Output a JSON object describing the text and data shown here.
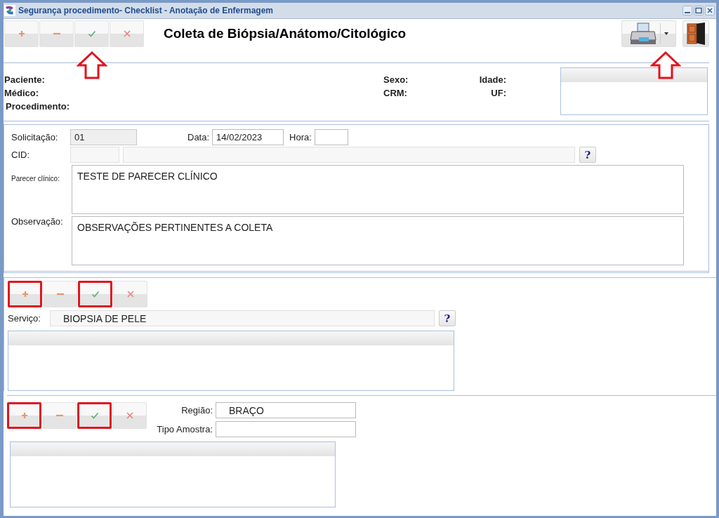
{
  "window": {
    "title": "Segurança procedimento- Checklist - Anotação de Enfermagem"
  },
  "toolbar": {
    "buttons": [
      {
        "kind": "add",
        "arrow": false
      },
      {
        "kind": "remove",
        "arrow": false
      },
      {
        "kind": "confirm",
        "arrow": true
      },
      {
        "kind": "cancel",
        "arrow": false
      }
    ]
  },
  "heading": "Coleta de Biópsia/Anátomo/Citológico",
  "actions": [
    {
      "kind": "print",
      "arrow": true
    },
    {
      "kind": "exit",
      "arrow": false
    }
  ],
  "patient": {
    "left": [
      "Paciente:",
      "Médico:",
      "Procedimento:"
    ],
    "middle": [
      "Sexo:",
      "CRM:"
    ],
    "right": [
      "Idade:",
      "UF:"
    ]
  },
  "form": {
    "solicitacao": {
      "label": "Solicitação:",
      "value": "01",
      "disabled": true
    },
    "data": {
      "label": "Data:",
      "value": "14/02/2023",
      "disabled": false
    },
    "hora": {
      "label": "Hora:",
      "disabled": false
    },
    "cid": {
      "label": "CID:",
      "disabled": true
    },
    "parecer": {
      "label": "Parecer clínico:",
      "value": "TESTE DE PARECER CLÍNICO"
    },
    "observacao": {
      "label": "Observação:",
      "value": "OBSERVAÇÕES PERTINENTES A COLETA"
    },
    "help": "?"
  },
  "servico_section": {
    "buttons": [
      {
        "kind": "add",
        "highlighted": true
      },
      {
        "kind": "remove",
        "highlighted": false
      },
      {
        "kind": "confirm",
        "highlighted": true
      },
      {
        "kind": "cancel",
        "highlighted": false
      }
    ],
    "field": {
      "label": "Serviço:",
      "value": "BIOPSIA DE PELE",
      "disabled": true
    },
    "help": "?"
  },
  "regiao_section": {
    "buttons": [
      {
        "kind": "add",
        "highlighted": true
      },
      {
        "kind": "remove",
        "highlighted": false
      },
      {
        "kind": "confirm",
        "highlighted": true
      },
      {
        "kind": "cancel",
        "highlighted": false
      }
    ],
    "regiao": {
      "label": "Região:",
      "value": "BRAÇO",
      "disabled": false
    },
    "tipo": {
      "label": "Tipo Amostra:",
      "disabled": false
    }
  }
}
